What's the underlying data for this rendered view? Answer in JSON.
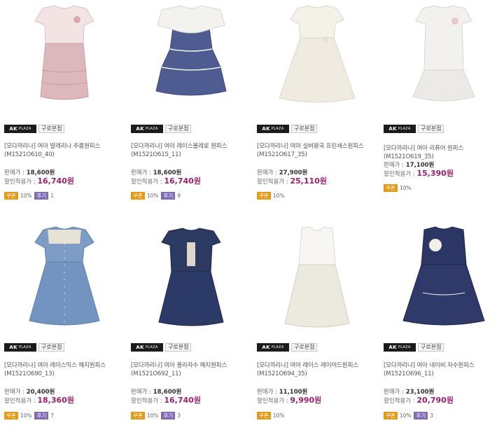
{
  "store": {
    "logo_text": "AK",
    "logo_sub": "PLAZA",
    "branch": "구로본점"
  },
  "labels": {
    "list_price": "판매가 :",
    "sale_price": "할인적용가 :",
    "coupon": "쿠폰",
    "review": "후기"
  },
  "products": [
    {
      "title": "[모다까리나] 여아 발레리나 주름원피스(M1521O610_40)",
      "price": "18,600원",
      "sale": "16,740원",
      "coupon_pct": "10%",
      "review_count": "1",
      "colors": {
        "top": "#f3e4e3",
        "skirt": "#dcb7bc"
      }
    },
    {
      "title": "[모다까리나] 여아 레이스볼레로 원피스(M1521O615_11)",
      "price": "18,600원",
      "sale": "16,740원",
      "coupon_pct": "10%",
      "review_count": "9",
      "colors": {
        "top": "#f4f2ee",
        "skirt": "#4e5c92"
      }
    },
    {
      "title": "[모다까리나] 여아 실버왕국 프린세스원피스(M1521O617_35)",
      "price": "27,900원",
      "sale": "25,110원",
      "coupon_pct": "10%",
      "review_count": null,
      "colors": {
        "top": "#f4f1e9",
        "skirt": "#efebe0"
      }
    },
    {
      "title": "[모다까리나] 여아 리퓨어 원피스(M1521O619_35)",
      "price": "17,100원",
      "sale": "15,390원",
      "coupon_pct": "10%",
      "review_count": null,
      "colors": {
        "top": "#f2f1ee",
        "skirt": "#eceae6"
      }
    },
    {
      "title": "[모다까리나] 여아 레이스믹스 해지원피스(M1521O690_13)",
      "price": "20,400원",
      "sale": "18,360원",
      "coupon_pct": "10%",
      "review_count": "7",
      "colors": {
        "top": "#7d9cc6",
        "skirt": "#7393c0"
      }
    },
    {
      "title": "[모다까리나] 여아 플라자수 해지원피스(M1521O692_11)",
      "price": "18,600원",
      "sale": "16,740원",
      "coupon_pct": "10%",
      "review_count": "3",
      "colors": {
        "top": "#2c3a62",
        "skirt": "#2b3a66"
      }
    },
    {
      "title": "[모다까리나] 여아 레이스 레이어드원피스(M1521O694_35)",
      "price": "11,100원",
      "sale": "9,990원",
      "coupon_pct": "10%",
      "review_count": null,
      "colors": {
        "top": "#f7f6f2",
        "skirt": "#ece9df"
      }
    },
    {
      "title": "[모다까리나] 여아 네이비 자수원피스(M1521O696_11)",
      "price": "23,100원",
      "sale": "20,790원",
      "coupon_pct": "10%",
      "review_count": "3",
      "colors": {
        "top": "#2b3665",
        "skirt": "#2f3a6a"
      }
    }
  ]
}
